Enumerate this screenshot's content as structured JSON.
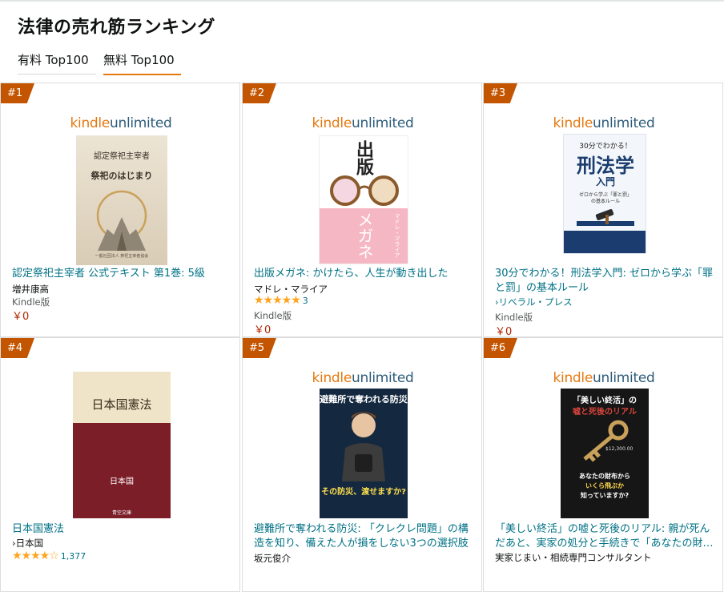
{
  "page": {
    "title": "法律の売れ筋ランキング"
  },
  "tabs": [
    {
      "label": "有料 Top100",
      "active": false
    },
    {
      "label": "無料 Top100",
      "active": true
    }
  ],
  "accent": "#e47911",
  "rank_badge_color": "#c45500",
  "kindle_unlimited": {
    "kindle": "kindle",
    "unlimited": "unlimited"
  },
  "items": [
    {
      "rank": "#1",
      "title": "認定祭祀主宰者 公式テキスト 第1巻: 5級",
      "author": "増井康高",
      "format": "Kindle版",
      "price": "￥0",
      "cover": {
        "series": "認定祭祀主宰者",
        "main": "祭祀のはじまり",
        "publisher": "一般社団法人 祭祀主宰者協会"
      }
    },
    {
      "rank": "#2",
      "title": "出版メガネ: かけたら、人生が動き出した",
      "author": "マドレ・マライア",
      "stars": "★★★★★",
      "rating_count": "3",
      "format": "Kindle版",
      "price": "￥0",
      "cover": {
        "top": "出版",
        "bottom": "メガネ",
        "side": "マドレ・マライア"
      }
    },
    {
      "rank": "#3",
      "title": "30分でわかる！刑法学入門: ゼロから学ぶ「罪と罰」の基本ルール",
      "author": "リベラル・プレス",
      "format": "Kindle版",
      "price": "￥0",
      "cover": {
        "small": "30分でわかる！",
        "main": "刑法学",
        "sub": "入門",
        "note": "ゼロから学ぶ「罪と罰」の基本ルール"
      }
    },
    {
      "rank": "#4",
      "title": "日本国憲法",
      "author": "日本国",
      "stars": "★★★★☆",
      "rating_count": "1,377",
      "cover": {
        "title": "日本国憲法",
        "author": "日本国",
        "label": "青空文庫"
      }
    },
    {
      "rank": "#5",
      "title": "避難所で奪われる防災: 「クレクレ問題」の構造を知り、備えた人が損をしない3つの選択肢",
      "author": "坂元俊介",
      "cover": {
        "top": "避難所で奪われる防災",
        "bottom": "その防災、渡せますか?"
      }
    },
    {
      "rank": "#6",
      "title": "「美しい終活」の嘘と死後のリアル: 親が死んだあと、実家の処分と手続きで「あなたの財…",
      "author": "実家じまい・相続専門コンサルタント",
      "cover": {
        "top1": "「美しい終活」の",
        "top2": "嘘と死後のリアル",
        "price": "$12,300.00",
        "mid": "あなたの財布から",
        "mid2": "いくら飛ぶか",
        "mid3": "知っていますか?"
      }
    }
  ]
}
